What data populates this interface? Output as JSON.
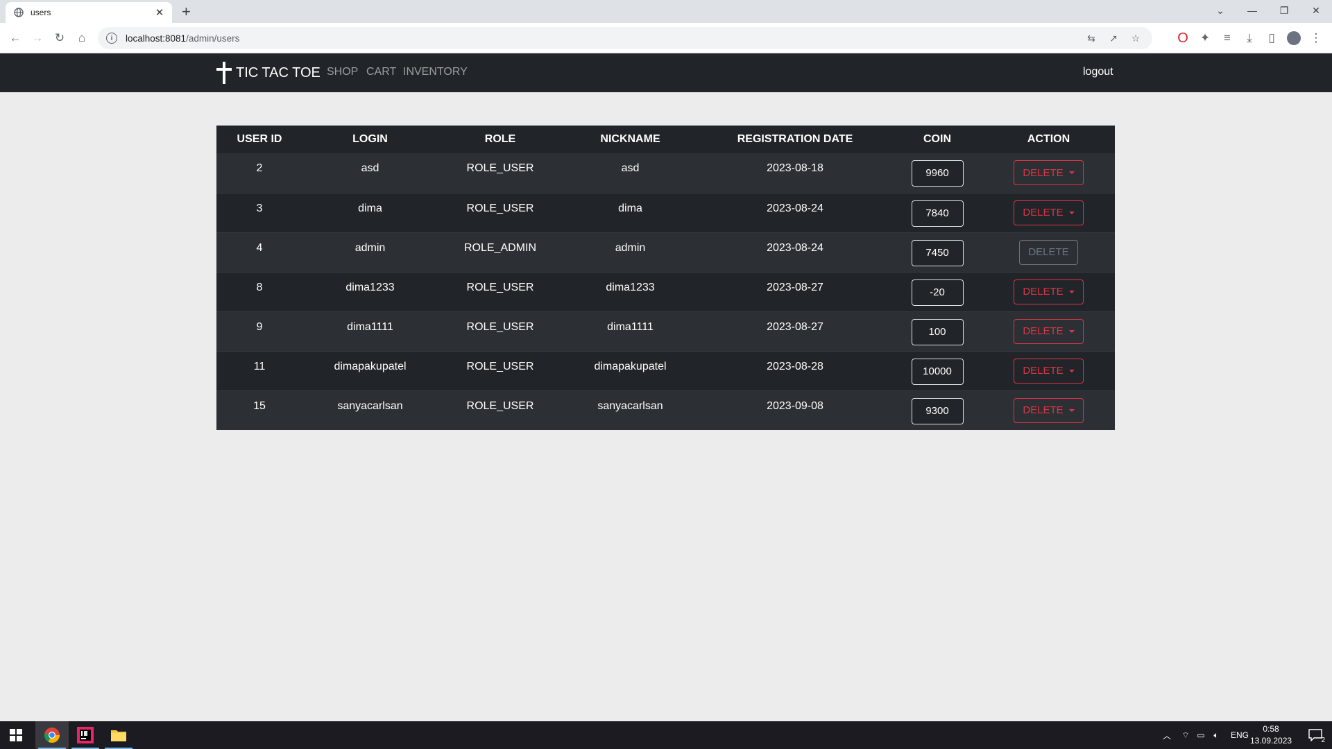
{
  "browser": {
    "tab_title": "users",
    "url_host": "localhost:8081",
    "url_path": "/admin/users"
  },
  "navbar": {
    "brand": "TIC TAC TOE",
    "links": [
      "SHOP",
      "CART",
      "INVENTORY"
    ],
    "logout": "logout"
  },
  "table": {
    "headers": [
      "USER ID",
      "LOGIN",
      "ROLE",
      "NICKNAME",
      "REGISTRATION DATE",
      "COIN",
      "ACTION"
    ],
    "rows": [
      {
        "id": "2",
        "login": "asd",
        "role": "ROLE_USER",
        "nickname": "asd",
        "date": "2023-08-18",
        "coin": "9960",
        "action": "DELETE",
        "enabled": true
      },
      {
        "id": "3",
        "login": "dima",
        "role": "ROLE_USER",
        "nickname": "dima",
        "date": "2023-08-24",
        "coin": "7840",
        "action": "DELETE",
        "enabled": true
      },
      {
        "id": "4",
        "login": "admin",
        "role": "ROLE_ADMIN",
        "nickname": "admin",
        "date": "2023-08-24",
        "coin": "7450",
        "action": "DELETE",
        "enabled": false
      },
      {
        "id": "8",
        "login": "dima1233",
        "role": "ROLE_USER",
        "nickname": "dima1233",
        "date": "2023-08-27",
        "coin": "-20",
        "action": "DELETE",
        "enabled": true
      },
      {
        "id": "9",
        "login": "dima1111",
        "role": "ROLE_USER",
        "nickname": "dima1111",
        "date": "2023-08-27",
        "coin": "100",
        "action": "DELETE",
        "enabled": true
      },
      {
        "id": "11",
        "login": "dimapakupatel",
        "role": "ROLE_USER",
        "nickname": "dimapakupatel",
        "date": "2023-08-28",
        "coin": "10000",
        "action": "DELETE",
        "enabled": true
      },
      {
        "id": "15",
        "login": "sanyacarlsan",
        "role": "ROLE_USER",
        "nickname": "sanyacarlsan",
        "date": "2023-09-08",
        "coin": "9300",
        "action": "DELETE",
        "enabled": true
      }
    ]
  },
  "taskbar": {
    "language": "ENG",
    "time": "0:58",
    "date": "13.09.2023",
    "notifications": "2"
  },
  "colors": {
    "navbar_bg": "#212529",
    "danger": "#dc3545",
    "page_bg": "#ececec"
  }
}
